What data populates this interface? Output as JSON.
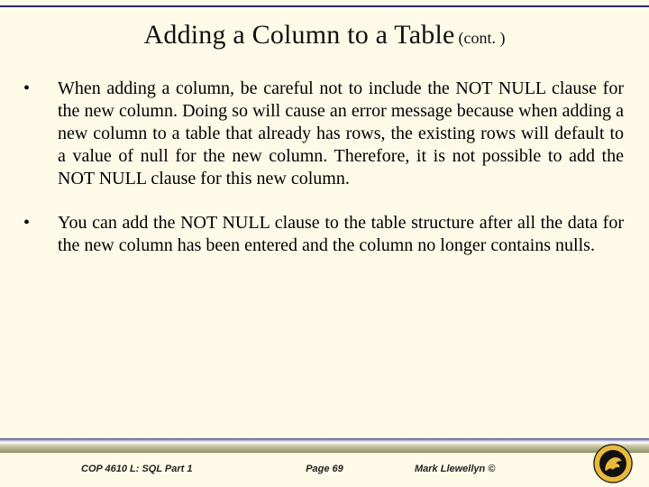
{
  "title": {
    "main": "Adding a Column to a Table",
    "suffix": "(cont. )"
  },
  "bullets": [
    "When adding a column, be careful not to include the NOT NULL clause for the new column.  Doing so will cause an error message because when adding a new column to a table that already has rows, the existing rows will default to a value of null for the new column.  Therefore, it is not possible to add the NOT NULL clause for this new column.",
    "You can add the NOT NULL clause to the table structure after all the data for the new column has been entered and the column no longer contains nulls."
  ],
  "footer": {
    "left": "COP 4610 L: SQL Part 1",
    "center": "Page 69",
    "right": "Mark Llewellyn ©"
  },
  "icons": {
    "logo": "pegasus-seal-icon"
  }
}
